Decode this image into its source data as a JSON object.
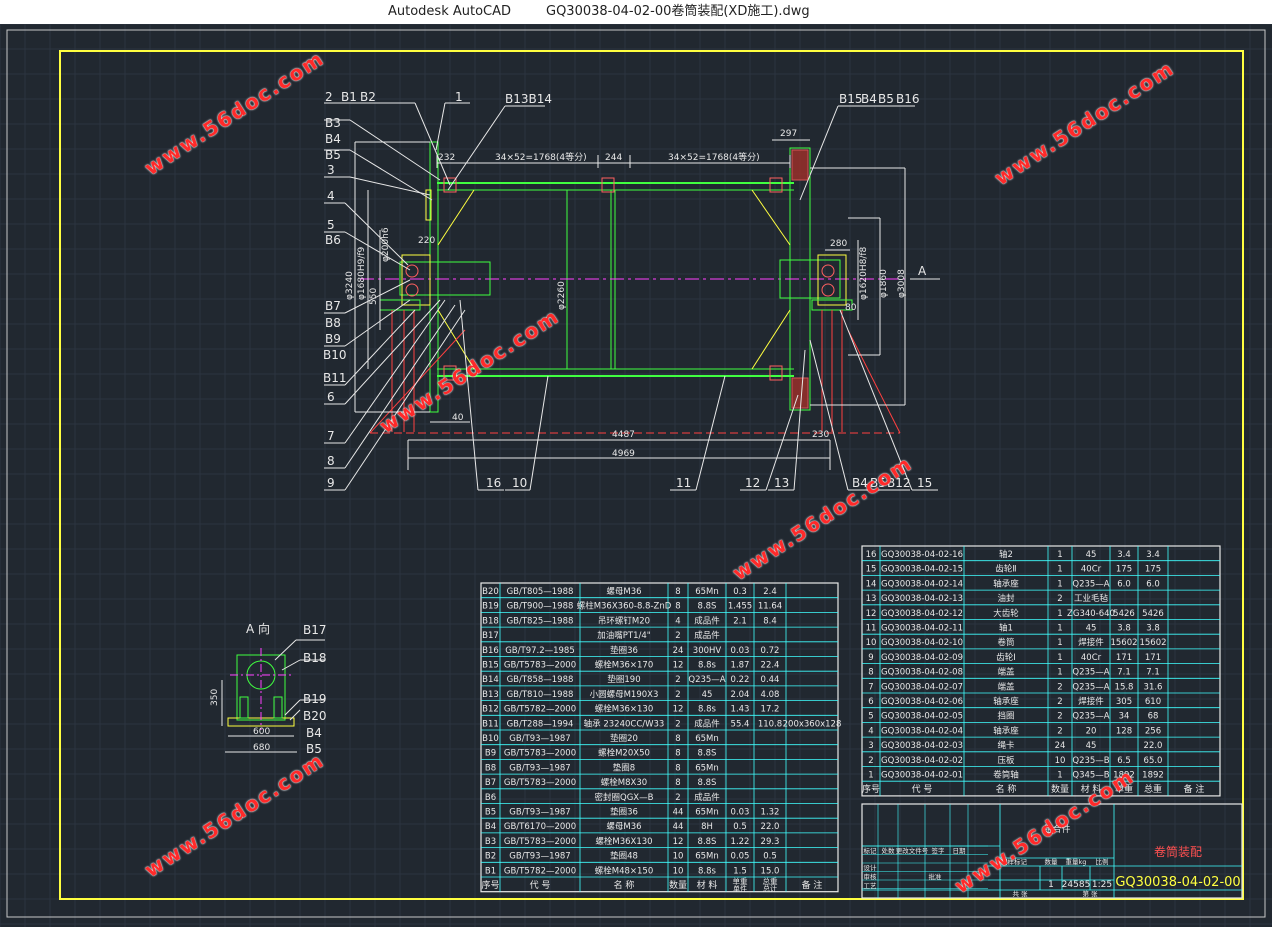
{
  "titlebar": {
    "app": "Autodesk AutoCAD",
    "document": "GQ30038-04-02-00卷筒装配(XD施工).dwg"
  },
  "watermark": "www.56doc.com",
  "drawing": {
    "view_label_a": "A 向",
    "callouts_top": [
      "2",
      "B1",
      "B2",
      "1",
      "B13B14",
      "B15",
      "B4",
      "B5",
      "B16"
    ],
    "callouts_left": [
      "B3",
      "B4",
      "B5",
      "3",
      "4",
      "5",
      "B6",
      "B7",
      "B8",
      "B9",
      "B10",
      "B11",
      "6",
      "7",
      "8",
      "9"
    ],
    "callouts_bottom": [
      "16",
      "10",
      "11",
      "12",
      "13",
      "B4",
      "B5",
      "B12",
      "15"
    ],
    "view_a_callouts": [
      "B17",
      "B18",
      "B19",
      "B20",
      "B4",
      "B5"
    ],
    "dimensions": {
      "d232": "232",
      "d244": "244",
      "d297": "297",
      "left_span": "34×52=1768(4等分)",
      "right_span": "34×52=1768(4等分)",
      "d220": "220",
      "d280": "280",
      "d200": "φ200h6",
      "d40": "40",
      "d80": "80",
      "d4487": "4487",
      "d4969": "4969",
      "d230": "230",
      "d2260": "φ2260",
      "d1860": "φ1860",
      "d3008": "φ3008",
      "d3240": "φ3240",
      "d1620": "φ1620H8/f8",
      "d1680": "φ1680H9/f9",
      "d550": "550",
      "d600": "600",
      "d680": "680",
      "d350": "350",
      "label_a": "A"
    }
  },
  "bom_left": {
    "rows": [
      [
        "B20",
        "GB/T805—1988",
        "螺母M36",
        "8",
        "65Mn",
        "0.3",
        "2.4",
        ""
      ],
      [
        "B19",
        "GB/T900—1988",
        "螺柱M36X360-8.8-ZnD",
        "8",
        "8.8S",
        "1.455",
        "11.64",
        ""
      ],
      [
        "B18",
        "GB/T825—1988",
        "吊环螺钉M20",
        "4",
        "成品件",
        "2.1",
        "8.4",
        ""
      ],
      [
        "B17",
        "",
        "加油嘴PT1/4\"",
        "2",
        "成品件",
        "",
        "",
        ""
      ],
      [
        "B16",
        "GB/T97.2—1985",
        "垫圈36",
        "24",
        "300HV",
        "0.03",
        "0.72",
        ""
      ],
      [
        "B15",
        "GB/T5783—2000",
        "螺栓M36×170",
        "12",
        "8.8s",
        "1.87",
        "22.4",
        ""
      ],
      [
        "B14",
        "GB/T858—1988",
        "垫圈190",
        "2",
        "Q235—A",
        "0.22",
        "0.44",
        ""
      ],
      [
        "B13",
        "GB/T810—1988",
        "小圆螺母M190X3",
        "2",
        "45",
        "2.04",
        "4.08",
        ""
      ],
      [
        "B12",
        "GB/T5782—2000",
        "螺栓M36×130",
        "12",
        "8.8s",
        "1.43",
        "17.2",
        ""
      ],
      [
        "B11",
        "GB/T288—1994",
        "轴承 23240CC/W33",
        "2",
        "成品件",
        "55.4",
        "110.8",
        "200x360x128"
      ],
      [
        "B10",
        "GB/T93—1987",
        "垫圈20",
        "8",
        "65Mn",
        "",
        "",
        ""
      ],
      [
        "B9",
        "GB/T5783—2000",
        "螺栓M20X50",
        "8",
        "8.8S",
        "",
        "",
        ""
      ],
      [
        "B8",
        "GB/T93—1987",
        "垫圈8",
        "8",
        "65Mn",
        "",
        "",
        ""
      ],
      [
        "B7",
        "GB/T5783—2000",
        "螺栓M8X30",
        "8",
        "8.8S",
        "",
        "",
        ""
      ],
      [
        "B6",
        "",
        "密封圈QGX—B",
        "2",
        "成品件",
        "",
        "",
        ""
      ],
      [
        "B5",
        "GB/T93—1987",
        "垫圈36",
        "44",
        "65Mn",
        "0.03",
        "1.32",
        ""
      ],
      [
        "B4",
        "GB/T6170—2000",
        "螺母M36",
        "44",
        "8H",
        "0.5",
        "22.0",
        ""
      ],
      [
        "B3",
        "GB/T5783—2000",
        "螺栓M36X130",
        "12",
        "8.8S",
        "1.22",
        "29.3",
        ""
      ],
      [
        "B2",
        "GB/T93—1987",
        "垫圈48",
        "10",
        "65Mn",
        "0.05",
        "0.5",
        ""
      ],
      [
        "B1",
        "GB/T5782—2000",
        "螺栓M48×150",
        "10",
        "8.8s",
        "1.5",
        "15.0",
        ""
      ]
    ],
    "header": [
      "序号",
      "代 号",
      "名 称",
      "数量",
      "材 料",
      "单重",
      "总重",
      "备 注"
    ],
    "weight_sub": [
      "单件",
      "总计"
    ]
  },
  "bom_right": {
    "rows": [
      [
        "16",
        "GQ30038-04-02-16",
        "轴2",
        "1",
        "45",
        "3.4",
        "3.4",
        ""
      ],
      [
        "15",
        "GQ30038-04-02-15",
        "齿轮Ⅱ",
        "1",
        "40Cr",
        "175",
        "175",
        ""
      ],
      [
        "14",
        "GQ30038-04-02-14",
        "轴承座",
        "1",
        "Q235—A",
        "6.0",
        "6.0",
        ""
      ],
      [
        "13",
        "GQ30038-04-02-13",
        "油封",
        "2",
        "工业毛毡",
        "",
        "",
        ""
      ],
      [
        "12",
        "GQ30038-04-02-12",
        "大齿轮",
        "1",
        "ZG340-640",
        "5426",
        "5426",
        ""
      ],
      [
        "11",
        "GQ30038-04-02-11",
        "轴1",
        "1",
        "45",
        "3.8",
        "3.8",
        ""
      ],
      [
        "10",
        "GQ30038-04-02-10",
        "卷筒",
        "1",
        "焊接件",
        "15602",
        "15602",
        ""
      ],
      [
        "9",
        "GQ30038-04-02-09",
        "齿轮Ⅰ",
        "1",
        "40Cr",
        "171",
        "171",
        ""
      ],
      [
        "8",
        "GQ30038-04-02-08",
        "端盖",
        "1",
        "Q235—A",
        "7.1",
        "7.1",
        ""
      ],
      [
        "7",
        "GQ30038-04-02-07",
        "端盖",
        "2",
        "Q235—A",
        "15.8",
        "31.6",
        ""
      ],
      [
        "6",
        "GQ30038-04-02-06",
        "轴承座",
        "2",
        "焊接件",
        "305",
        "610",
        ""
      ],
      [
        "5",
        "GQ30038-04-02-05",
        "挡圈",
        "2",
        "Q235—A",
        "34",
        "68",
        ""
      ],
      [
        "4",
        "GQ30038-04-02-04",
        "轴承座",
        "2",
        "20",
        "128",
        "256",
        ""
      ],
      [
        "3",
        "GQ30038-04-02-03",
        "绳卡",
        "24",
        "45",
        "",
        "22.0",
        ""
      ],
      [
        "2",
        "GQ30038-04-02-02",
        "压板",
        "10",
        "Q235—B",
        "6.5",
        "65.0",
        ""
      ],
      [
        "1",
        "GQ30038-04-02-01",
        "卷筒轴",
        "1",
        "Q345—B",
        "1892",
        "1892",
        ""
      ]
    ],
    "header": [
      "序号",
      "代 号",
      "名 称",
      "数量",
      "材 料",
      "单重",
      "总重",
      "备 注"
    ]
  },
  "title_block": {
    "assembly_label": "组合件",
    "name": "卷筒装配",
    "drawing_number": "GQ30038-04-02-00",
    "weight": "24585",
    "scale": "1:25",
    "qty": "1",
    "labels": [
      "标记",
      "处数",
      "更改文件号",
      "签字",
      "日期",
      "设计",
      "审核",
      "工艺",
      "批准",
      "图样标记",
      "数量",
      "重量kg",
      "比例",
      "共 张",
      "第 张"
    ]
  }
}
